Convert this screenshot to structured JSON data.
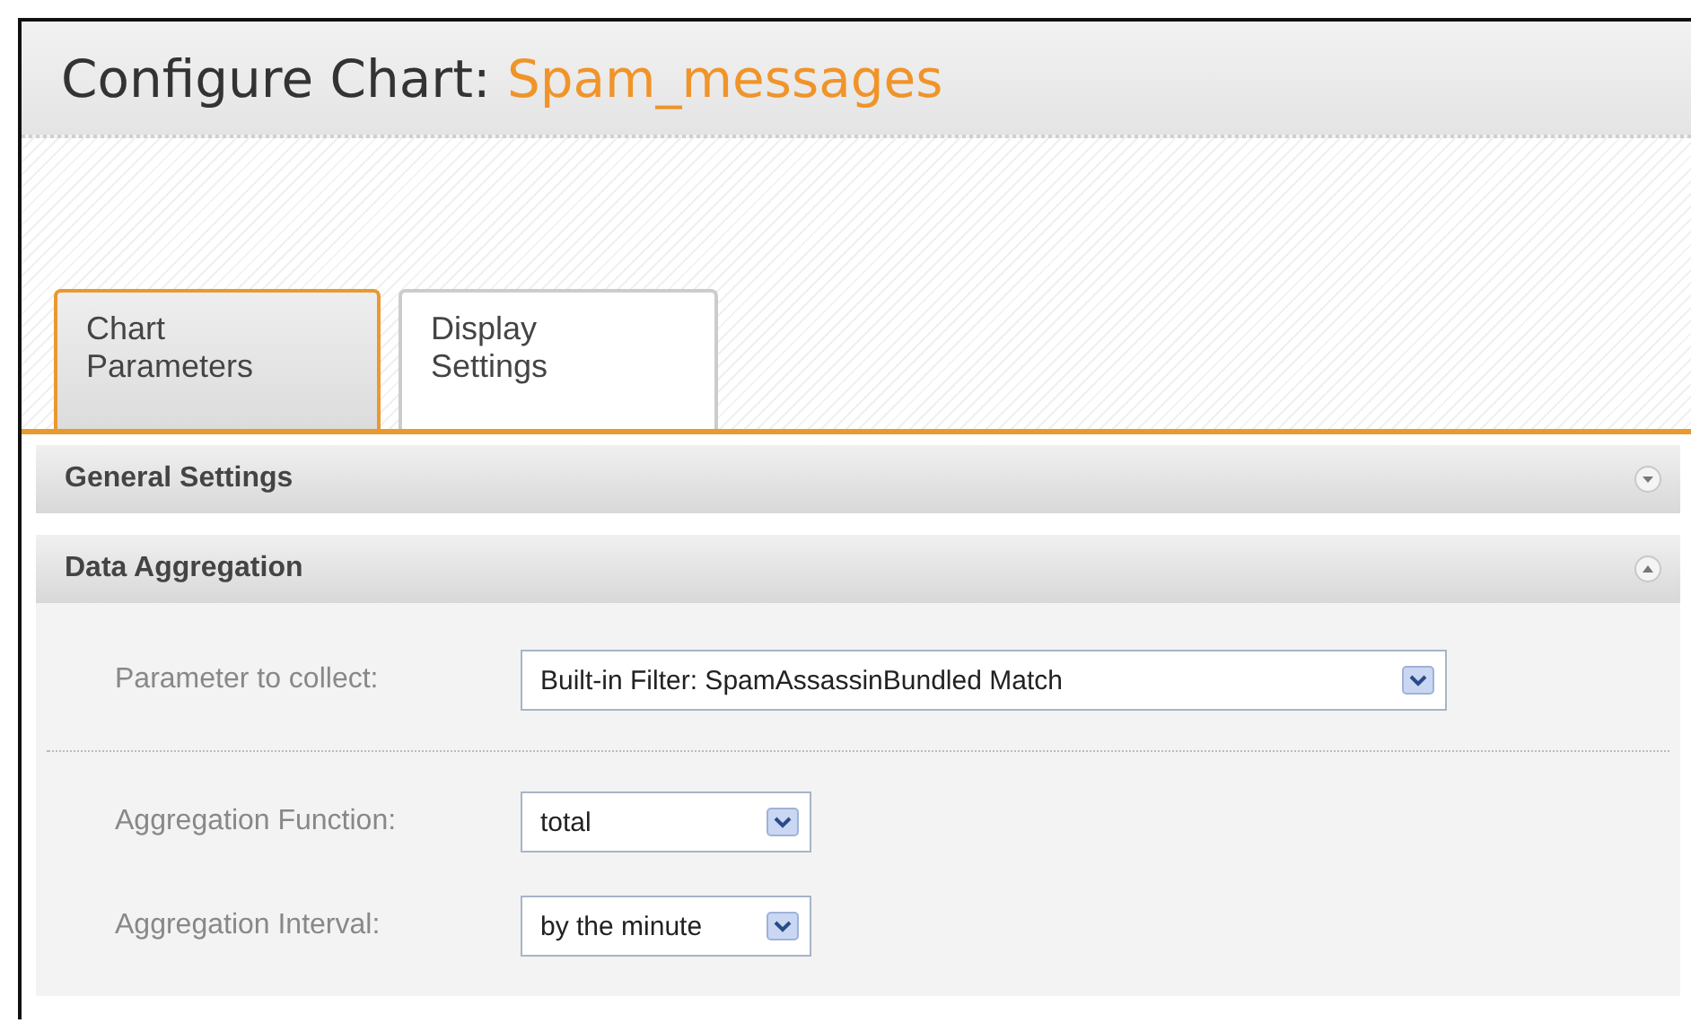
{
  "title": {
    "label": "Configure Chart:",
    "name": "Spam_messages"
  },
  "tabs": [
    {
      "line1": "Chart",
      "line2": "Parameters",
      "selected": true
    },
    {
      "line1": "Display",
      "line2": "Settings",
      "selected": false
    }
  ],
  "sections": [
    {
      "title": "General Settings",
      "expanded": false
    },
    {
      "title": "Data Aggregation",
      "expanded": true,
      "fields": [
        {
          "label": "Parameter to collect:",
          "value": "Built-in Filter: SpamAssassinBundled Match",
          "wide": true,
          "divider_after": true
        },
        {
          "label": "Aggregation Function:",
          "value": "total",
          "wide": false,
          "divider_after": false
        },
        {
          "label": "Aggregation Interval:",
          "value": "by the minute",
          "wide": false,
          "divider_after": false
        }
      ]
    }
  ]
}
